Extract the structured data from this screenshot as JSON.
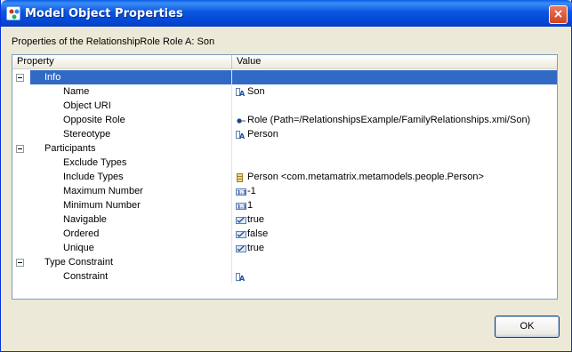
{
  "window": {
    "title": "Model Object Properties",
    "heading": "Properties of the RelationshipRole Role A: Son"
  },
  "table": {
    "columns": {
      "property": "Property",
      "value": "Value"
    },
    "rows": [
      {
        "kind": "category",
        "label": "Info",
        "selected": true
      },
      {
        "kind": "property",
        "label": "Name",
        "value": "Son",
        "icon": "text-icon"
      },
      {
        "kind": "property",
        "label": "Object URI",
        "value": "",
        "icon": ""
      },
      {
        "kind": "property",
        "label": "Opposite Role",
        "value": "Role (Path=/RelationshipsExample/FamilyRelationships.xmi/Son)",
        "icon": "role-icon"
      },
      {
        "kind": "property",
        "label": "Stereotype",
        "value": "Person",
        "icon": "text-icon"
      },
      {
        "kind": "category",
        "label": "Participants"
      },
      {
        "kind": "property",
        "label": "Exclude Types",
        "value": "",
        "icon": ""
      },
      {
        "kind": "property",
        "label": "Include Types",
        "value": "Person <com.metamatrix.metamodels.people.Person>",
        "icon": "class-icon"
      },
      {
        "kind": "property",
        "label": "Maximum Number",
        "value": "-1",
        "icon": "number-icon"
      },
      {
        "kind": "property",
        "label": "Minimum Number",
        "value": "1",
        "icon": "number-icon"
      },
      {
        "kind": "property",
        "label": "Navigable",
        "value": "true",
        "icon": "boolean-icon"
      },
      {
        "kind": "property",
        "label": "Ordered",
        "value": "false",
        "icon": "boolean-icon"
      },
      {
        "kind": "property",
        "label": "Unique",
        "value": "true",
        "icon": "boolean-icon"
      },
      {
        "kind": "category",
        "label": "Type Constraint"
      },
      {
        "kind": "property",
        "label": "Constraint",
        "value": "",
        "icon": "text-icon"
      }
    ]
  },
  "buttons": {
    "ok": "OK",
    "close": "×"
  },
  "colors": {
    "titlebar": "#0a56e0",
    "selection": "#316ac5",
    "dialog": "#ece9d8"
  }
}
